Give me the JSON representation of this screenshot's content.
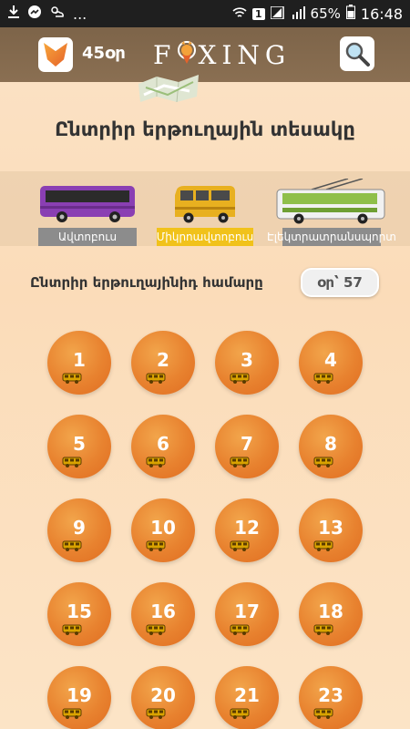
{
  "status_bar": {
    "battery": "65%",
    "time": "16:48",
    "sim": "1",
    "overflow": "..."
  },
  "header": {
    "points": "45օր",
    "logo_left": "F",
    "logo_right": "XING",
    "app_icon": "fox-icon",
    "search_icon": "magnifier-icon"
  },
  "main": {
    "title": "Ընտրիր երթուղային տեսակը",
    "vehicles": [
      {
        "label": "Ավտոբուս",
        "icon": "bus-icon",
        "selected": false
      },
      {
        "label": "Միկրոավտոբուս",
        "icon": "minibus-icon",
        "selected": true
      },
      {
        "label": "Էլեկտրատրանսպորտ",
        "icon": "trolleybus-icon",
        "selected": false
      }
    ],
    "subtitle": "Ընտրիր երթուղայինիդ համարը",
    "counter": "օր՝ 57",
    "routes": [
      "1",
      "2",
      "3",
      "4",
      "5",
      "6",
      "7",
      "8",
      "9",
      "10",
      "12",
      "13",
      "15",
      "16",
      "17",
      "18",
      "19",
      "20",
      "21",
      "23"
    ]
  },
  "colors": {
    "header_bg": "#7d6449",
    "route_orange": "#e8822f",
    "active_label": "#f1c21b",
    "inactive_label": "#8c8c8c"
  }
}
